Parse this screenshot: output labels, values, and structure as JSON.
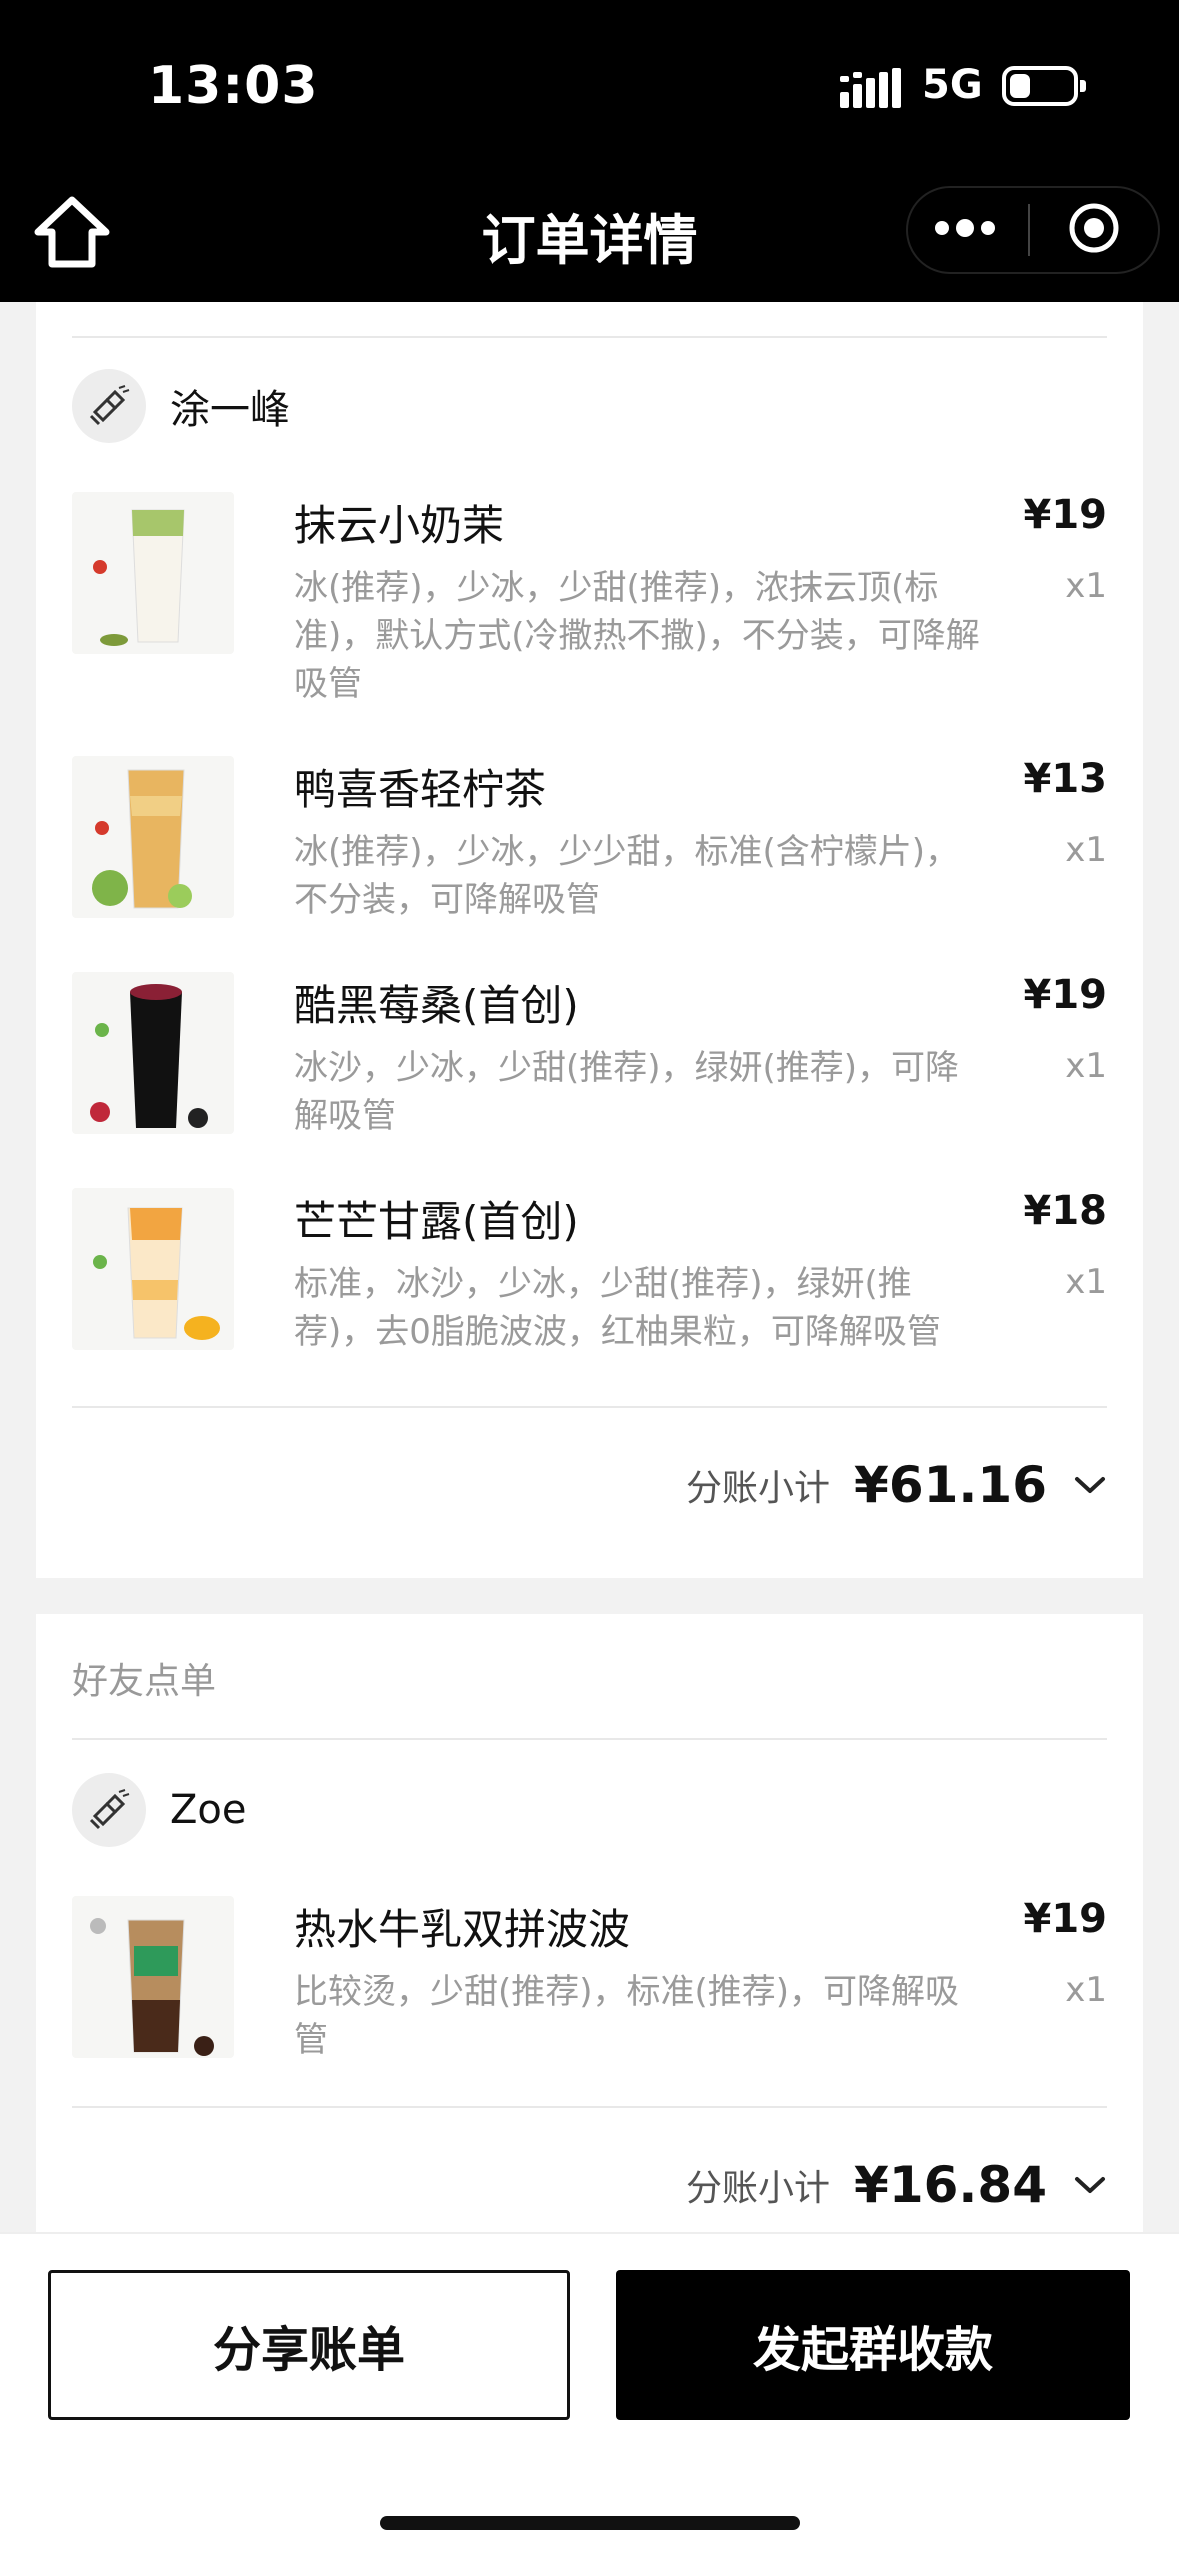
{
  "status_bar": {
    "time": "13:03",
    "network": "5G"
  },
  "nav": {
    "title": "订单详情"
  },
  "my_order": {
    "user": "涂一峰",
    "items": [
      {
        "name": "抹云小奶茉",
        "options": "冰(推荐)，少冰，少甜(推荐)，浓抹云顶(标准)，默认方式(冷撒热不撒)，不分装，可降解吸管",
        "price": "¥19",
        "qty": "x1"
      },
      {
        "name": "鸭喜香轻柠茶",
        "options": "冰(推荐)，少冰，少少甜，标准(含柠檬片)，不分装，可降解吸管",
        "price": "¥13",
        "qty": "x1"
      },
      {
        "name": "酷黑莓桑(首创)",
        "options": "冰沙，少冰，少甜(推荐)，绿妍(推荐)，可降解吸管",
        "price": "¥19",
        "qty": "x1"
      },
      {
        "name": "芒芒甘露(首创)",
        "options": "标准，冰沙，少冰，少甜(推荐)，绿妍(推荐)，去0脂脆波波，红柚果粒，可降解吸管",
        "price": "¥18",
        "qty": "x1"
      }
    ],
    "subtotal_label": "分账小计",
    "subtotal": "¥61.16"
  },
  "friend_order": {
    "section_label": "好友点单",
    "user": "Zoe",
    "items": [
      {
        "name": "热水牛乳双拼波波",
        "options": "比较烫，少甜(推荐)，标准(推荐)，可降解吸管",
        "price": "¥19",
        "qty": "x1"
      }
    ],
    "subtotal_label": "分账小计",
    "subtotal": "¥16.84"
  },
  "actions": {
    "share": "分享账单",
    "collect": "发起群收款"
  }
}
